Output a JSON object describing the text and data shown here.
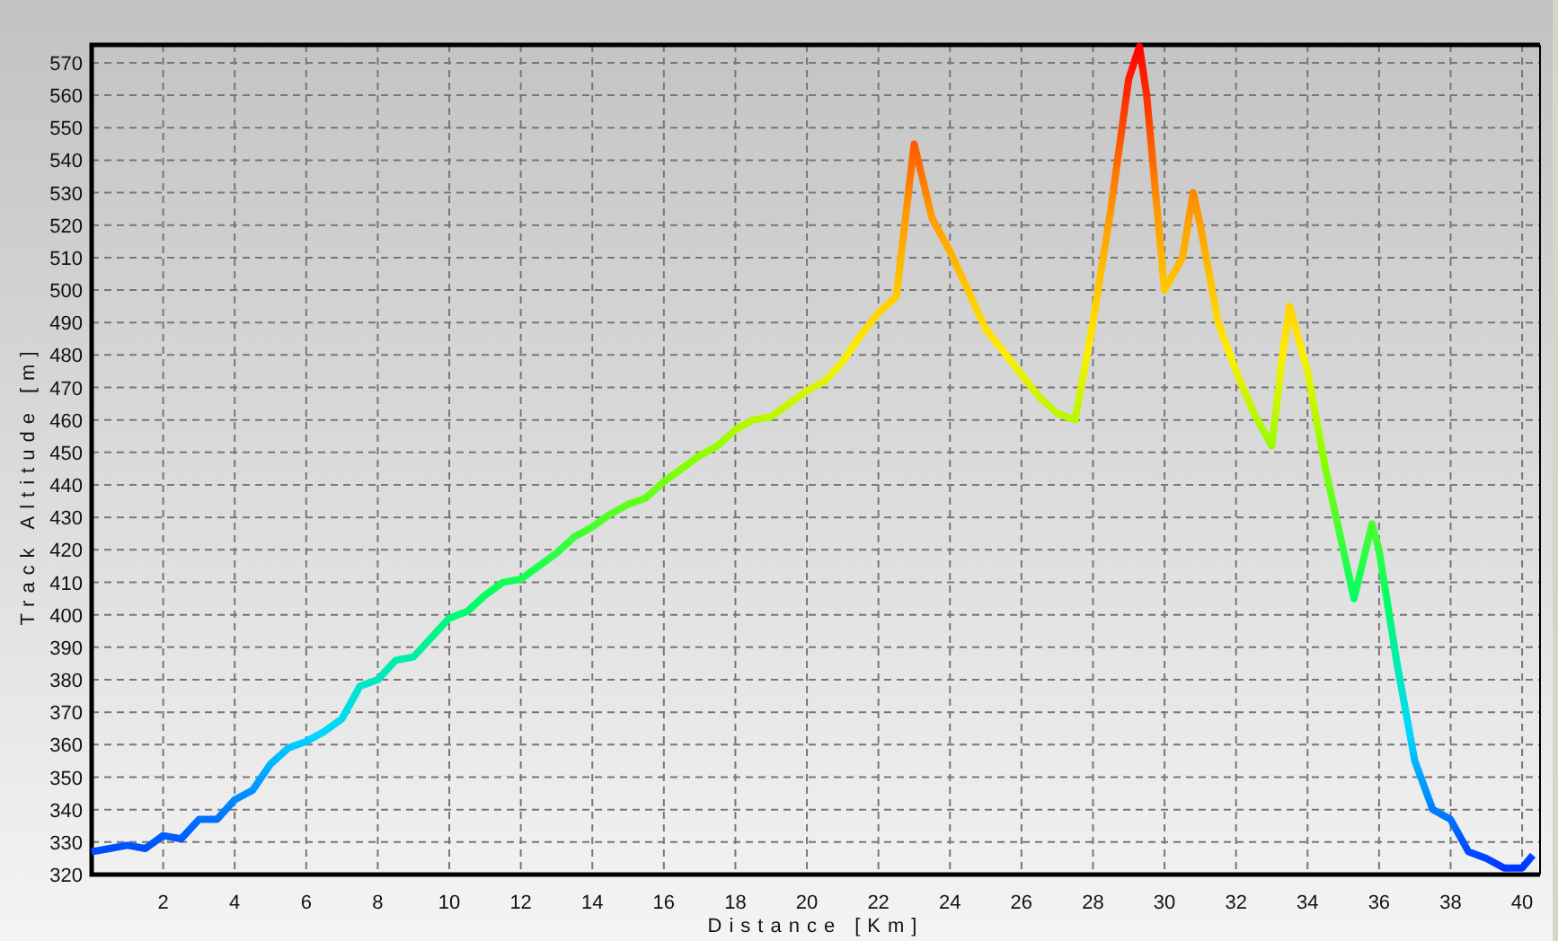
{
  "chart_data": {
    "type": "line",
    "xlabel": "Distance [Km]",
    "ylabel": "Track Altitude [m]",
    "x": [
      0,
      0.5,
      1,
      1.5,
      2,
      2.5,
      3,
      3.5,
      4,
      4.5,
      5,
      5.5,
      6,
      6.5,
      7,
      7.5,
      8,
      8.5,
      9,
      9.5,
      10,
      10.5,
      11,
      11.5,
      12,
      12.5,
      13,
      13.5,
      14,
      14.5,
      15,
      15.5,
      16,
      16.5,
      17,
      17.5,
      18,
      18.5,
      19,
      19.5,
      20,
      20.5,
      21,
      21.5,
      22,
      22.5,
      23,
      23.5,
      24,
      24.5,
      25,
      25.5,
      26,
      26.5,
      27,
      27.5,
      28,
      28.5,
      29,
      29.3,
      29.5,
      30,
      30.5,
      30.8,
      31,
      31.5,
      32,
      32.5,
      33,
      33.3,
      33.5,
      34,
      34.5,
      35,
      35.3,
      35.8,
      36,
      36.5,
      37,
      37.5,
      38,
      38.5,
      39,
      39.5,
      40,
      40.3
    ],
    "grid": true,
    "series": [
      {
        "values": [
          327,
          328,
          329,
          328,
          332,
          331,
          337,
          337,
          343,
          346,
          354,
          359,
          361,
          364,
          368,
          378,
          380,
          386,
          387,
          393,
          399,
          401,
          406,
          410,
          411,
          415,
          419,
          424,
          427,
          431,
          434,
          436,
          441,
          445,
          449,
          452,
          457,
          460,
          461,
          465,
          469,
          472,
          478,
          486,
          493,
          498,
          545,
          522,
          512,
          500,
          488,
          481,
          474,
          467,
          462,
          460,
          490,
          525,
          565,
          575,
          560,
          500,
          510,
          530,
          520,
          490,
          475,
          462,
          452,
          480,
          495,
          475,
          445,
          420,
          405,
          428,
          420,
          385,
          355,
          340,
          337,
          327,
          325,
          322,
          322,
          326
        ]
      }
    ],
    "xlim": [
      0,
      40.5
    ],
    "ylim": [
      320,
      575.5
    ],
    "xticks": [
      2,
      4,
      6,
      8,
      10,
      12,
      14,
      16,
      18,
      20,
      22,
      24,
      26,
      28,
      30,
      32,
      34,
      36,
      38,
      40
    ],
    "yticks": [
      320,
      330,
      340,
      350,
      360,
      370,
      380,
      390,
      400,
      410,
      420,
      430,
      440,
      450,
      460,
      470,
      480,
      490,
      500,
      510,
      520,
      530,
      540,
      550,
      560,
      570
    ]
  }
}
